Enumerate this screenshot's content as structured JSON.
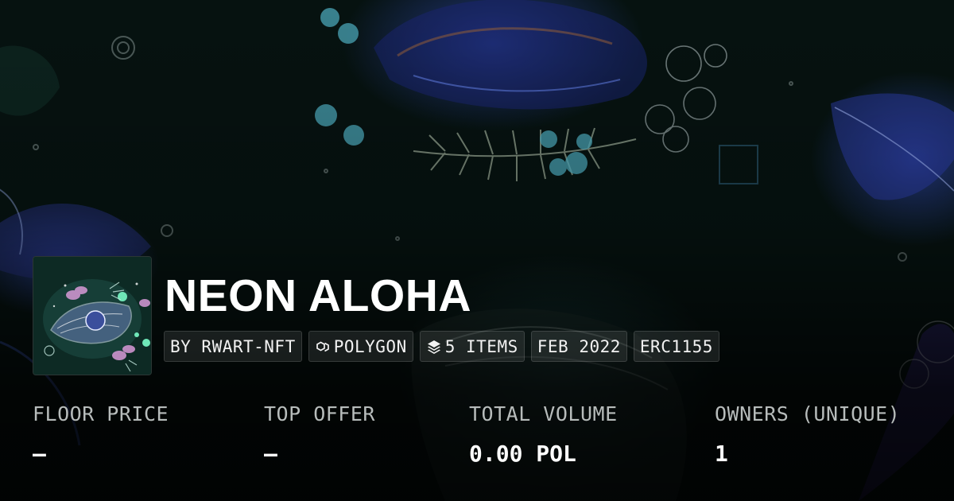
{
  "collection": {
    "name": "NEON ALOHA",
    "logo_icon": "neon-floral-artwork",
    "background_art": "neon-floral-banner"
  },
  "chips": [
    {
      "label": "BY RWART-NFT",
      "icon": ""
    },
    {
      "label": "POLYGON",
      "icon": "polygon-chain-icon"
    },
    {
      "label": "5 ITEMS",
      "icon": "layers-icon"
    },
    {
      "label": "FEB 2022",
      "icon": ""
    },
    {
      "label": "ERC1155",
      "icon": ""
    }
  ],
  "stats": [
    {
      "label": "FLOOR PRICE",
      "value": "–"
    },
    {
      "label": "TOP OFFER",
      "value": "–"
    },
    {
      "label": "TOTAL VOLUME",
      "value": "0.00 POL"
    },
    {
      "label": "OWNERS (UNIQUE)",
      "value": "1"
    }
  ],
  "colors": {
    "background": "#061210",
    "chip_background": "#2a3331",
    "label_text": "#b7bcbb",
    "neon_blue": "#3d4fc9",
    "neon_teal": "#62d3e0"
  }
}
